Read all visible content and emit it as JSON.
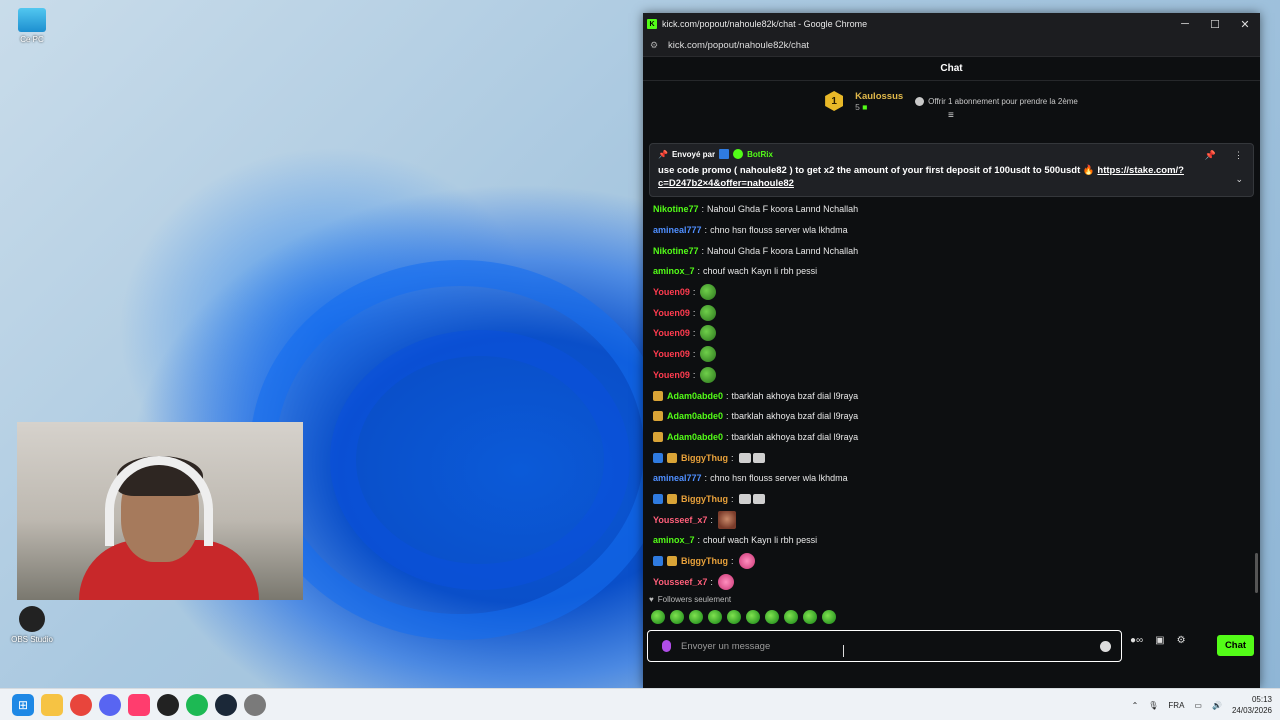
{
  "desktop": {
    "icons": [
      {
        "label": "Ce PC",
        "icon": "computer-icon"
      },
      {
        "label": "OBS Studio",
        "icon": "obs-icon"
      }
    ]
  },
  "window": {
    "title": "kick.com/popout/nahoule82k/chat - Google Chrome",
    "url": "kick.com/popout/nahoule82k/chat",
    "controls": {
      "minimize": "─",
      "maximize": "☐",
      "close": "✕"
    }
  },
  "chat": {
    "header": "Chat",
    "gifter": {
      "rank": "1",
      "name": "Kaulossus",
      "count": "5",
      "offer": "Offrir 1 abonnement pour prendre la 2ème"
    },
    "pinned": {
      "sent_by_label": "Envoyé par",
      "author": "BotRix",
      "message": "use code promo ( nahoule82 ) to get x2 the amount of your first deposit of 100usdt to 500usdt 🔥",
      "link": "https://stake.com/?c=D247b2×4&offer=nahoule82"
    },
    "messages": [
      {
        "user": "Nikotine77",
        "color": "#53fc18",
        "text": "Nahoul Ghda F koora Lannd Nchallah",
        "badges": [],
        "emotes": 0,
        "emote_type": ""
      },
      {
        "user": "amineal777",
        "color": "#4f8fff",
        "text": "chno hsn flouss server wla lkhdma",
        "badges": [],
        "emotes": 0,
        "emote_type": ""
      },
      {
        "user": "Nikotine77",
        "color": "#53fc18",
        "text": "Nahoul Ghda F koora Lannd Nchallah",
        "badges": [],
        "emotes": 0,
        "emote_type": ""
      },
      {
        "user": "aminox_7",
        "color": "#53fc18",
        "text": "chouf wach Kayn li rbh pessi",
        "badges": [],
        "emotes": 0,
        "emote_type": ""
      },
      {
        "user": "Youen09",
        "color": "#ff3b4f",
        "text": "",
        "badges": [],
        "emotes": 1,
        "emote_type": "pepe"
      },
      {
        "user": "Youen09",
        "color": "#ff3b4f",
        "text": "",
        "badges": [],
        "emotes": 1,
        "emote_type": "pepe"
      },
      {
        "user": "Youen09",
        "color": "#ff3b4f",
        "text": "",
        "badges": [],
        "emotes": 1,
        "emote_type": "pepe"
      },
      {
        "user": "Youen09",
        "color": "#ff3b4f",
        "text": "",
        "badges": [],
        "emotes": 1,
        "emote_type": "pepe"
      },
      {
        "user": "Youen09",
        "color": "#ff3b4f",
        "text": "",
        "badges": [],
        "emotes": 1,
        "emote_type": "pepe"
      },
      {
        "user": "Adam0abde0",
        "color": "#53fc18",
        "text": "tbarklah akhoya bzaf dial l9raya",
        "badges": [
          "gold"
        ],
        "emotes": 0,
        "emote_type": ""
      },
      {
        "user": "Adam0abde0",
        "color": "#53fc18",
        "text": "tbarklah akhoya bzaf dial l9raya",
        "badges": [
          "gold"
        ],
        "emotes": 0,
        "emote_type": ""
      },
      {
        "user": "Adam0abde0",
        "color": "#53fc18",
        "text": "tbarklah akhoya bzaf dial l9raya",
        "badges": [
          "gold"
        ],
        "emotes": 0,
        "emote_type": ""
      },
      {
        "user": "BiggyThug",
        "color": "#e9a23b",
        "text": "",
        "badges": [
          "blue",
          "gold"
        ],
        "emotes": 2,
        "emote_type": "small"
      },
      {
        "user": "amineal777",
        "color": "#4f8fff",
        "text": "chno hsn flouss server wla lkhdma",
        "badges": [],
        "emotes": 0,
        "emote_type": ""
      },
      {
        "user": "BiggyThug",
        "color": "#e9a23b",
        "text": "",
        "badges": [
          "blue",
          "gold"
        ],
        "emotes": 2,
        "emote_type": "small"
      },
      {
        "user": "Yousseef_x7",
        "color": "#ff5f7a",
        "text": "",
        "badges": [],
        "emotes": 1,
        "emote_type": "face"
      },
      {
        "user": "aminox_7",
        "color": "#53fc18",
        "text": "chouf wach Kayn li rbh pessi",
        "badges": [],
        "emotes": 0,
        "emote_type": ""
      },
      {
        "user": "BiggyThug",
        "color": "#e9a23b",
        "text": "",
        "badges": [
          "blue",
          "gold"
        ],
        "emotes": 1,
        "emote_type": "pink"
      },
      {
        "user": "Yousseef_x7",
        "color": "#ff5f7a",
        "text": "",
        "badges": [],
        "emotes": 1,
        "emote_type": "pink"
      }
    ],
    "followers_only": "Followers seulement",
    "input": {
      "placeholder": "Envoyer un message"
    },
    "send_label": "Chat"
  },
  "taskbar": {
    "language": "FRA",
    "time": "05:13",
    "date": "24/03/2026"
  },
  "colors": {
    "kick_green": "#53fc18",
    "chat_bg": "#0d0f11"
  }
}
